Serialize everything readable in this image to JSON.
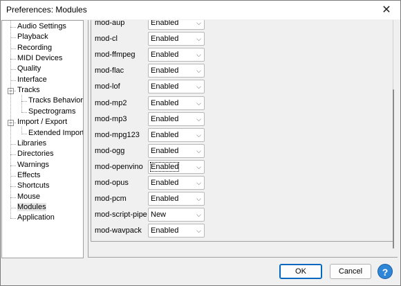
{
  "window": {
    "title": "Preferences: Modules",
    "close_glyph": "✕"
  },
  "tree": {
    "items": [
      {
        "label": "Audio Settings"
      },
      {
        "label": "Playback"
      },
      {
        "label": "Recording"
      },
      {
        "label": "MIDI Devices"
      },
      {
        "label": "Quality"
      },
      {
        "label": "Interface"
      },
      {
        "label": "Tracks",
        "expander": "−"
      },
      {
        "label": "Tracks Behaviors"
      },
      {
        "label": "Spectrograms"
      },
      {
        "label": "Import / Export",
        "expander": "−"
      },
      {
        "label": "Extended Import"
      },
      {
        "label": "Libraries"
      },
      {
        "label": "Directories"
      },
      {
        "label": "Warnings"
      },
      {
        "label": "Effects"
      },
      {
        "label": "Shortcuts"
      },
      {
        "label": "Mouse"
      },
      {
        "label": "Modules",
        "selected": true
      },
      {
        "label": "Application"
      }
    ]
  },
  "modules": [
    {
      "name": "mod-aup",
      "value": "Enabled"
    },
    {
      "name": "mod-cl",
      "value": "Enabled"
    },
    {
      "name": "mod-ffmpeg",
      "value": "Enabled"
    },
    {
      "name": "mod-flac",
      "value": "Enabled"
    },
    {
      "name": "mod-lof",
      "value": "Enabled"
    },
    {
      "name": "mod-mp2",
      "value": "Enabled"
    },
    {
      "name": "mod-mp3",
      "value": "Enabled"
    },
    {
      "name": "mod-mpg123",
      "value": "Enabled"
    },
    {
      "name": "mod-ogg",
      "value": "Enabled"
    },
    {
      "name": "mod-openvino",
      "value": "Enabled",
      "focused": true
    },
    {
      "name": "mod-opus",
      "value": "Enabled"
    },
    {
      "name": "mod-pcm",
      "value": "Enabled"
    },
    {
      "name": "mod-script-pipe",
      "value": "New"
    },
    {
      "name": "mod-wavpack",
      "value": "Enabled"
    }
  ],
  "buttons": {
    "ok": "OK",
    "cancel": "Cancel",
    "help": "?"
  },
  "icons": {
    "chevron": "chevron-down-icon",
    "help": "help-icon",
    "close": "close-icon"
  }
}
